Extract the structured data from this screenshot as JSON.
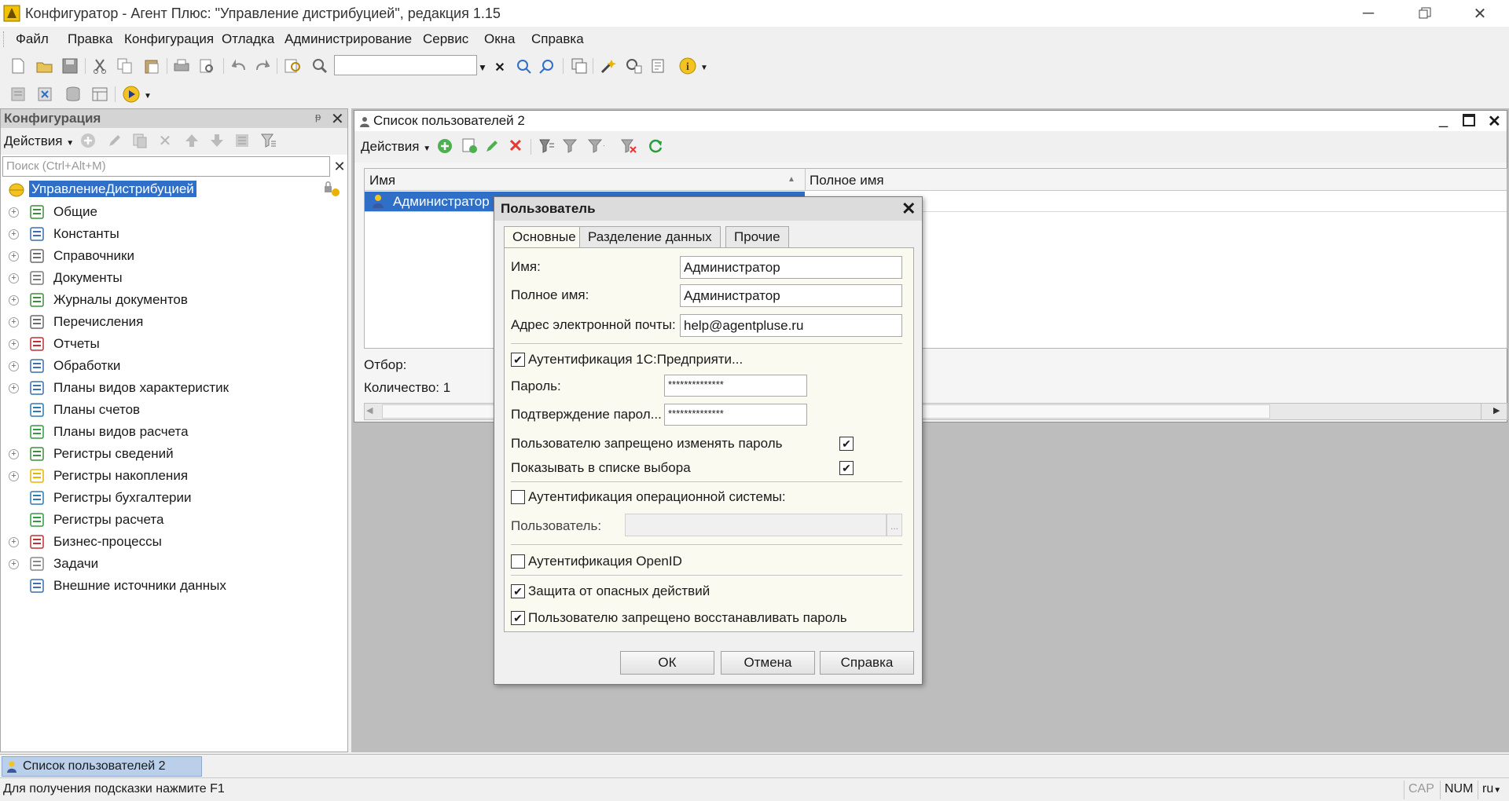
{
  "window": {
    "title": "Конфигуратор - Агент Плюс: \"Управление дистрибуцией\", редакция 1.15"
  },
  "menu": [
    "Файл",
    "Правка",
    "Конфигурация",
    "Отладка",
    "Администрирование",
    "Сервис",
    "Окна",
    "Справка"
  ],
  "left_panel": {
    "title": "Конфигурация",
    "actions_label": "Действия",
    "search_placeholder": "Поиск (Ctrl+Alt+M)",
    "root": "УправлениеДистрибуцией",
    "tree": [
      {
        "label": "Общие",
        "icon": "common-icon",
        "expandable": true
      },
      {
        "label": "Константы",
        "icon": "constants-icon",
        "expandable": true
      },
      {
        "label": "Справочники",
        "icon": "catalogs-icon",
        "expandable": true
      },
      {
        "label": "Документы",
        "icon": "documents-icon",
        "expandable": true
      },
      {
        "label": "Журналы документов",
        "icon": "journals-icon",
        "expandable": true
      },
      {
        "label": "Перечисления",
        "icon": "enums-icon",
        "expandable": true
      },
      {
        "label": "Отчеты",
        "icon": "reports-icon",
        "expandable": true
      },
      {
        "label": "Обработки",
        "icon": "processings-icon",
        "expandable": true
      },
      {
        "label": "Планы видов характеристик",
        "icon": "characteristics-icon",
        "expandable": true
      },
      {
        "label": "Планы счетов",
        "icon": "accounts-icon",
        "expandable": false
      },
      {
        "label": "Планы видов расчета",
        "icon": "calc-types-icon",
        "expandable": false
      },
      {
        "label": "Регистры сведений",
        "icon": "info-registers-icon",
        "expandable": true
      },
      {
        "label": "Регистры накопления",
        "icon": "accum-registers-icon",
        "expandable": true
      },
      {
        "label": "Регистры бухгалтерии",
        "icon": "accounting-registers-icon",
        "expandable": false
      },
      {
        "label": "Регистры расчета",
        "icon": "calc-registers-icon",
        "expandable": false
      },
      {
        "label": "Бизнес-процессы",
        "icon": "business-processes-icon",
        "expandable": true
      },
      {
        "label": "Задачи",
        "icon": "tasks-icon",
        "expandable": true
      },
      {
        "label": "Внешние источники данных",
        "icon": "external-sources-icon",
        "expandable": false
      }
    ]
  },
  "list_window": {
    "title": "Список пользователей 2",
    "actions_label": "Действия",
    "columns": [
      "Имя",
      "Полное имя"
    ],
    "rows": [
      {
        "name": "Администратор",
        "full_name": ""
      }
    ],
    "filter_label": "Отбор:",
    "count_label": "Количество: 1"
  },
  "dialog": {
    "title": "Пользователь",
    "tabs": [
      "Основные",
      "Разделение данных",
      "Прочие"
    ],
    "fields": {
      "name_label": "Имя:",
      "name_value": "Администратор",
      "fullname_label": "Полное имя:",
      "fullname_value": "Администратор",
      "email_label": "Адрес электронной почты:",
      "email_value": "help@agentpluse.ru",
      "auth_1c_label": "Аутентификация 1С:Предприяти...",
      "auth_1c_checked": true,
      "password_label": "Пароль:",
      "password_value": "**************",
      "confirm_label": "Подтверждение парол...",
      "confirm_value": "**************",
      "no_change_pwd_label": "Пользователю запрещено изменять пароль",
      "no_change_pwd_checked": true,
      "show_in_list_label": "Показывать в списке выбора",
      "show_in_list_checked": true,
      "auth_os_label": "Аутентификация операционной системы:",
      "auth_os_checked": false,
      "os_user_label": "Пользователь:",
      "os_user_value": "",
      "os_user_browse": "...",
      "auth_openid_label": "Аутентификация OpenID",
      "auth_openid_checked": false,
      "danger_protect_label": "Защита от опасных действий",
      "danger_protect_checked": true,
      "no_restore_pwd_label": "Пользователю запрещено восстанавливать пароль",
      "no_restore_pwd_checked": true
    },
    "buttons": {
      "ok": "ОК",
      "cancel": "Отмена",
      "help": "Справка"
    }
  },
  "taskbar": {
    "item": "Список пользователей 2"
  },
  "statusbar": {
    "hint": "Для получения подсказки нажмите F1",
    "cap": "CAP",
    "num": "NUM",
    "lang": "ru"
  },
  "colors": {
    "selection": "#2f6fc7",
    "dialog_panel": "#fafaf0",
    "mdi_bg": "#bdbdbd"
  }
}
